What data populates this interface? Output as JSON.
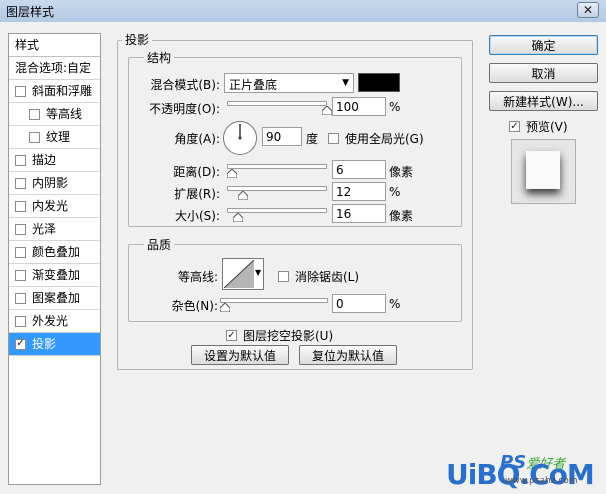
{
  "window": {
    "title": "图层样式",
    "close_glyph": "✕"
  },
  "sidebar": {
    "title": "样式",
    "blend_options": "混合选项:自定",
    "items": [
      {
        "label": "斜面和浮雕",
        "checked": false,
        "indent": false,
        "active": false
      },
      {
        "label": "等高线",
        "checked": false,
        "indent": true,
        "active": false
      },
      {
        "label": "纹理",
        "checked": false,
        "indent": true,
        "active": false
      },
      {
        "label": "描边",
        "checked": false,
        "indent": false,
        "active": false
      },
      {
        "label": "内阴影",
        "checked": false,
        "indent": false,
        "active": false
      },
      {
        "label": "内发光",
        "checked": false,
        "indent": false,
        "active": false
      },
      {
        "label": "光泽",
        "checked": false,
        "indent": false,
        "active": false
      },
      {
        "label": "颜色叠加",
        "checked": false,
        "indent": false,
        "active": false
      },
      {
        "label": "渐变叠加",
        "checked": false,
        "indent": false,
        "active": false
      },
      {
        "label": "图案叠加",
        "checked": false,
        "indent": false,
        "active": false
      },
      {
        "label": "外发光",
        "checked": false,
        "indent": false,
        "active": false
      },
      {
        "label": "投影",
        "checked": true,
        "indent": false,
        "active": true
      }
    ]
  },
  "panel": {
    "legend": "投影",
    "structure": {
      "legend": "结构",
      "blend_mode_label": "混合模式(B):",
      "blend_mode_value": "正片叠底",
      "shadow_color": "#000000",
      "opacity_label": "不透明度(O):",
      "opacity_value": "100",
      "opacity_unit": "%",
      "opacity_level": 1.0,
      "angle_label": "角度(A):",
      "angle_value": "90",
      "angle_unit": "度",
      "global_light_label": "使用全局光(G)",
      "global_light_checked": false,
      "distance_label": "距离(D):",
      "distance_value": "6",
      "distance_unit": "像素",
      "distance_level": 0.0,
      "spread_label": "扩展(R):",
      "spread_value": "12",
      "spread_unit": "%",
      "spread_level": 0.12,
      "size_label": "大小(S):",
      "size_value": "16",
      "size_unit": "像素",
      "size_level": 0.06
    },
    "quality": {
      "legend": "品质",
      "contour_label": "等高线:",
      "antialias_label": "消除锯齿(L)",
      "antialias_checked": false,
      "noise_label": "杂色(N):",
      "noise_value": "0",
      "noise_unit": "%",
      "noise_level": 0.0
    },
    "knockout_label": "图层挖空投影(U)",
    "knockout_checked": true,
    "make_default": "设置为默认值",
    "reset_default": "复位为默认值"
  },
  "buttons": {
    "ok": "确定",
    "cancel": "取消",
    "new_style": "新建样式(W)...",
    "preview_label": "预览(V)",
    "preview_checked": true
  },
  "watermark": {
    "brand": "UiBQ.CoM",
    "ps": "PS",
    "cn": "爱好者",
    "url": "www.psahz.com"
  },
  "colors": {
    "accent": "#3399ff",
    "watermark_blue": "#2a6fc9",
    "watermark_green": "#3aa33a"
  },
  "icons": {
    "checkmark": "✓",
    "dropdown": "▼"
  }
}
